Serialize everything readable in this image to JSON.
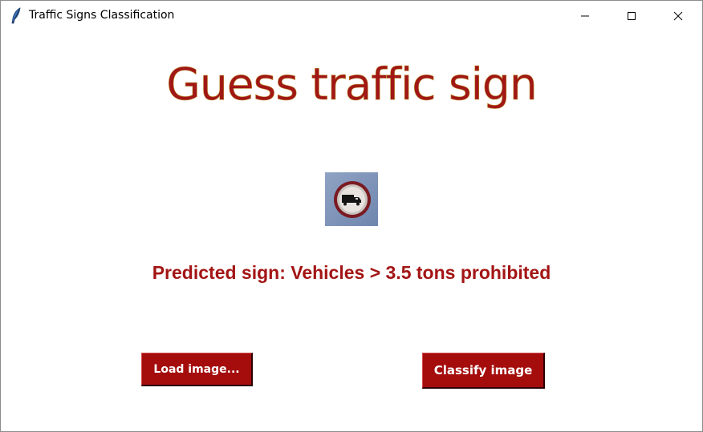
{
  "window": {
    "title": "Traffic Signs Classification",
    "app_icon": "feather-icon",
    "controls": [
      "minimize-icon",
      "maximize-icon",
      "close-icon"
    ]
  },
  "main": {
    "heading": "Guess traffic sign",
    "sign_image": {
      "icon": "truck-prohibited-sign",
      "alt": "Vehicles > 3.5 tons prohibited"
    },
    "prediction": "Predicted sign: Vehicles > 3.5 tons prohibited"
  },
  "buttons": {
    "load_label": "Load image...",
    "classify_label": "Classify image"
  },
  "colors": {
    "accent": "#a11616",
    "button_bg": "#a50d0d",
    "button_text": "#ffffff"
  }
}
